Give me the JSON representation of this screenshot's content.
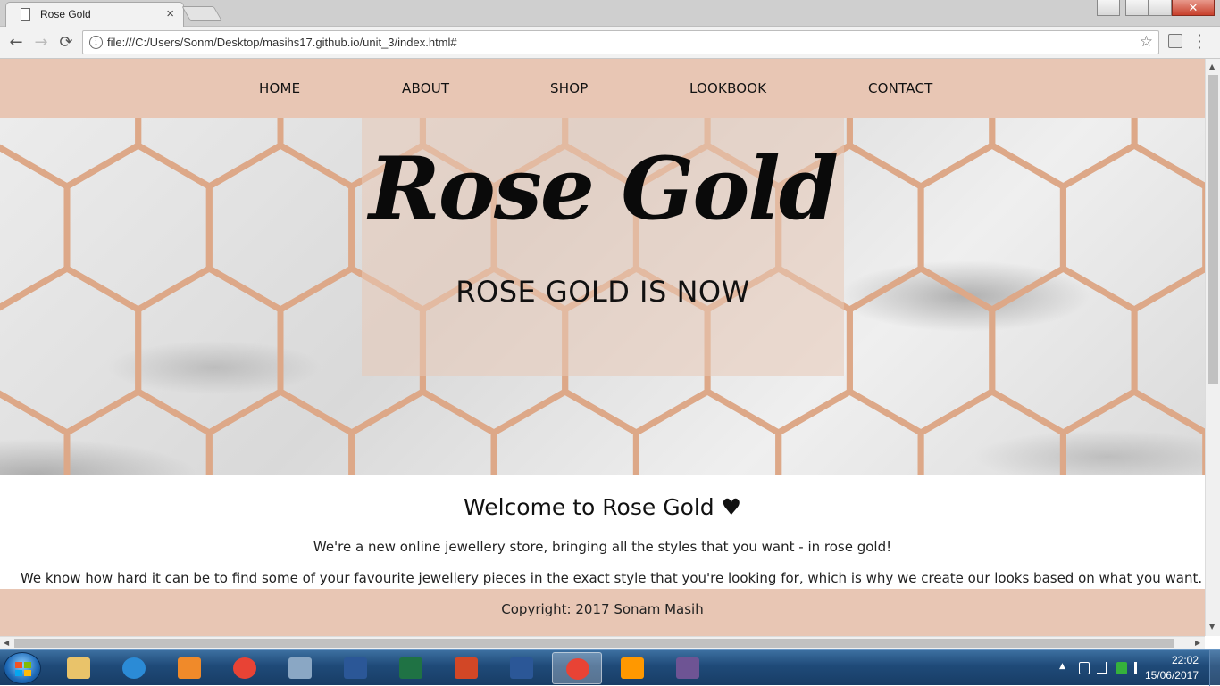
{
  "browser": {
    "tab_title": "Rose Gold",
    "tab_close": "×",
    "url": "file:///C:/Users/Sonm/Desktop/masihs17.github.io/unit_3/index.html#",
    "back": "←",
    "forward": "→",
    "reload": "⟳",
    "star": "☆",
    "info": "i",
    "window_close": "✕"
  },
  "nav": {
    "items": [
      {
        "label": "HOME"
      },
      {
        "label": "ABOUT"
      },
      {
        "label": "SHOP"
      },
      {
        "label": "LOOKBOOK"
      },
      {
        "label": "CONTACT"
      }
    ]
  },
  "hero": {
    "title": "Rose Gold",
    "subtitle": "ROSE GOLD IS NOW"
  },
  "content": {
    "welcome": "Welcome to Rose Gold ♥",
    "paragraph1": "We're a new online jewellery store, bringing all the styles that you want - in rose gold!",
    "paragraph2": "We know how hard it can be to find some of your favourite jewellery pieces in the exact style that you're looking for, which is why we create our looks based on what you want."
  },
  "footer": {
    "copyright": "Copyright: 2017 Sonam Masih"
  },
  "taskbar": {
    "apps": [
      {
        "icon": "file-explorer-icon",
        "color": "#e9c36a"
      },
      {
        "icon": "internet-explorer-icon",
        "color": "#2b8bd6"
      },
      {
        "icon": "media-player-icon",
        "color": "#f08a2a"
      },
      {
        "icon": "chrome-icon",
        "color": "#e84335"
      },
      {
        "icon": "network-tool-icon",
        "color": "#8aa7c4"
      },
      {
        "icon": "word-doc-icon",
        "color": "#2b5797"
      },
      {
        "icon": "excel-icon",
        "color": "#1f7244"
      },
      {
        "icon": "powerpoint-icon",
        "color": "#d24726"
      },
      {
        "icon": "word-icon",
        "color": "#2b5797"
      },
      {
        "icon": "chrome-icon",
        "color": "#e84335"
      },
      {
        "icon": "sublime-text-icon",
        "color": "#ff9800"
      },
      {
        "icon": "github-desktop-icon",
        "color": "#6e5494"
      }
    ],
    "clock_time": "22:02",
    "clock_date": "15/06/2017"
  },
  "colors": {
    "rose": "#e8c6b4",
    "honeycomb": "#dda888"
  }
}
